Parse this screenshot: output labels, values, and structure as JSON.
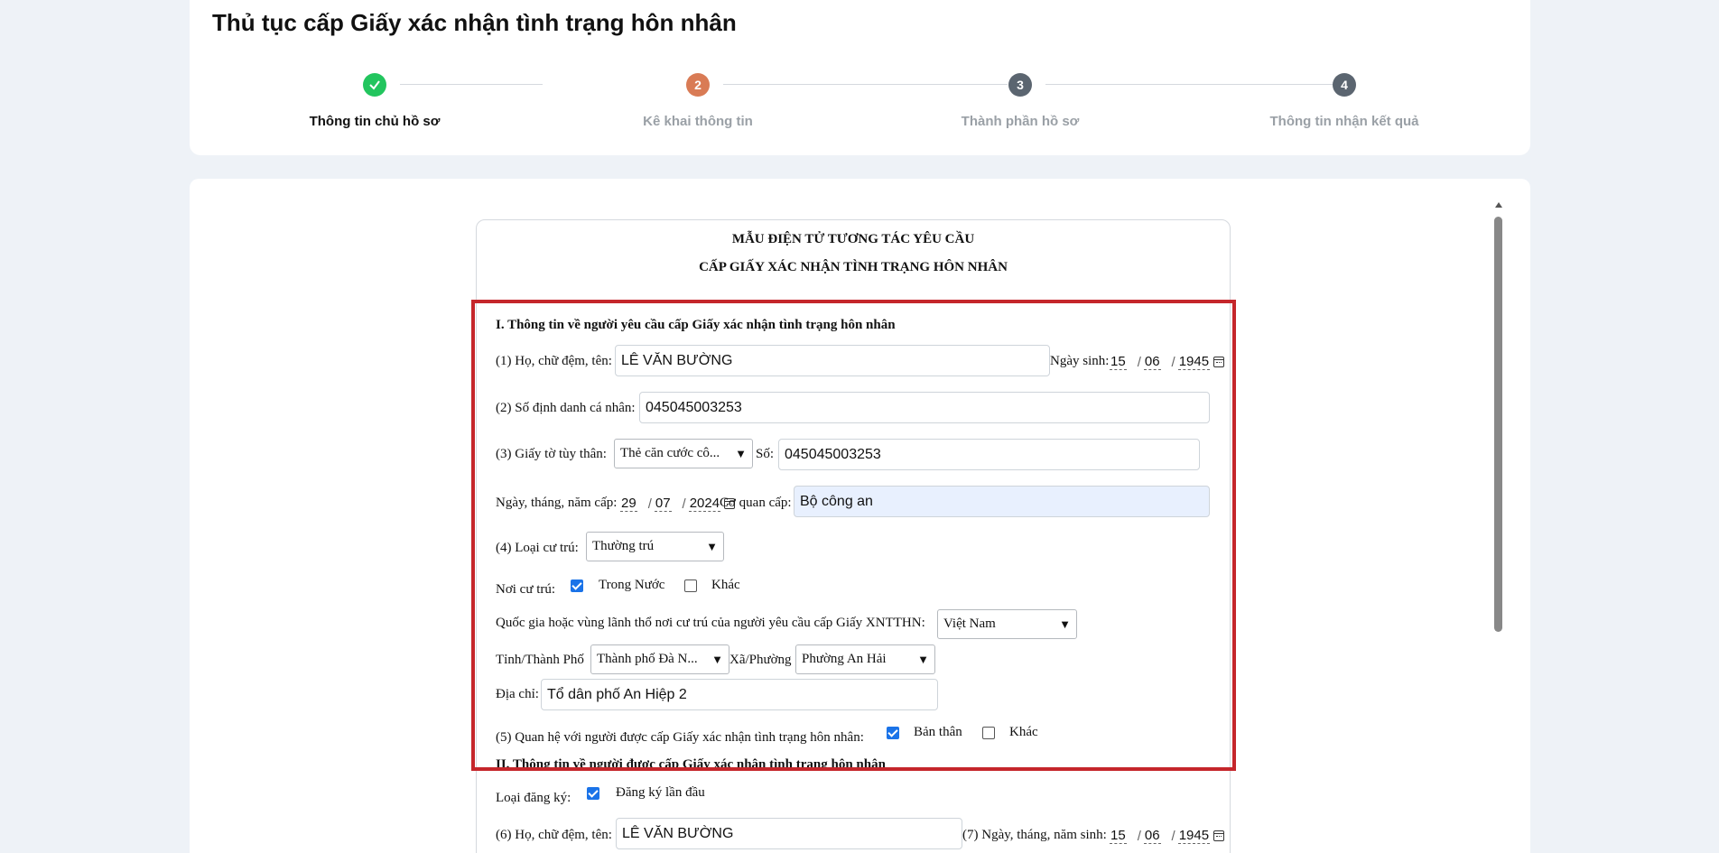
{
  "page": {
    "title": "Thủ tục cấp Giấy xác nhận tình trạng hôn nhân"
  },
  "steps": [
    {
      "number": "",
      "label": "Thông tin chủ hồ sơ",
      "status": "done"
    },
    {
      "number": "2",
      "label": "Kê khai thông tin",
      "status": "current"
    },
    {
      "number": "3",
      "label": "Thành phần hồ sơ",
      "status": "pending"
    },
    {
      "number": "4",
      "label": "Thông tin nhận kết quả",
      "status": "pending"
    }
  ],
  "colors": {
    "done": "#22c55e",
    "current": "#d97b55",
    "pending": "#5b6570",
    "highlight": "#c5262b",
    "checkbox": "#1a73e8"
  },
  "form": {
    "title_line1": "MẪU ĐIỆN TỬ TƯƠNG TÁC YÊU CẦU",
    "title_line2": "CẤP GIẤY XÁC NHẬN TÌNH TRẠNG HÔN NHÂN",
    "section1_title": "I. Thông tin về người yêu cầu cấp Giấy xác nhận tình trạng hôn nhân",
    "name_label": "(1) Họ, chữ đệm, tên:",
    "name_value": "LÊ VĂN BƯỜNG",
    "dob_label": "Ngày sinh:",
    "dob_day": "15",
    "dob_month": "06",
    "dob_year": "1945",
    "id_label": "(2) Số định danh cá nhân:",
    "id_value": "045045003253",
    "doc_label": "(3) Giấy tờ tùy thân:",
    "doc_type": "Thẻ căn cước cô...",
    "doc_no_label": "Số:",
    "doc_no_value": "045045003253",
    "issue_date_label": "Ngày, tháng, năm cấp:",
    "issue_day": "29",
    "issue_month": "07",
    "issue_year": "2024",
    "issuer_label": "Cơ quan cấp:",
    "issuer_value": "Bộ công an",
    "residence_type_label": "(4) Loại cư trú:",
    "residence_type_value": "Thường trú",
    "residence_place_label": "Nơi cư trú:",
    "residence_domestic": "Trong Nước",
    "residence_other": "Khác",
    "country_label": "Quốc gia hoặc vùng lãnh thổ nơi cư trú của người yêu cầu cấp Giấy XNTTHN:",
    "country_value": "Việt Nam",
    "province_label": "Tỉnh/Thành Phố",
    "province_value": "Thành phố Đà N...",
    "ward_label": "Xã/Phường",
    "ward_value": "Phường An Hải",
    "address_label": "Địa chỉ:",
    "address_value": "Tổ dân phố An Hiệp 2",
    "relation_label": "(5) Quan hệ với người được cấp Giấy xác nhận tình trạng hôn nhân:",
    "relation_self": "Bản thân",
    "relation_other": "Khác",
    "section2_title": "II. Thông tin về người được cấp Giấy xác nhận tình trạng hôn nhân",
    "reg_type_label": "Loại đăng ký:",
    "reg_type_value": "Đăng ký lần đầu",
    "name2_label": "(6) Họ, chữ đệm, tên:",
    "name2_value": "LÊ VĂN BƯỜNG",
    "dob2_label": "(7) Ngày, tháng, năm sinh:",
    "dob2_day": "15",
    "dob2_month": "06",
    "dob2_year": "1945"
  }
}
